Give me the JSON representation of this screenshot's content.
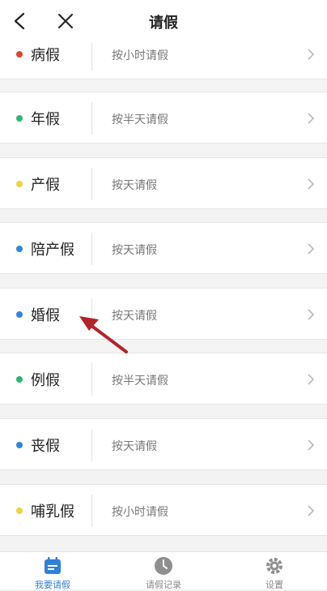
{
  "header": {
    "title": "请假"
  },
  "leave_types": [
    {
      "name": "病假",
      "desc": "按小时请假",
      "color": "#e0452e"
    },
    {
      "name": "年假",
      "desc": "按半天请假",
      "color": "#2bb673"
    },
    {
      "name": "产假",
      "desc": "按天请假",
      "color": "#f2d23c"
    },
    {
      "name": "陪产假",
      "desc": "按天请假",
      "color": "#2f88dd"
    },
    {
      "name": "婚假",
      "desc": "按天请假",
      "color": "#2f88dd"
    },
    {
      "name": "例假",
      "desc": "按半天请假",
      "color": "#2bb673"
    },
    {
      "name": "丧假",
      "desc": "按天请假",
      "color": "#2f88dd"
    },
    {
      "name": "哺乳假",
      "desc": "按小时请假",
      "color": "#f2d23c"
    }
  ],
  "tabs": [
    {
      "label": "我要请假",
      "icon": "calendar-icon",
      "active": true
    },
    {
      "label": "请假记录",
      "icon": "clock-icon",
      "active": false
    },
    {
      "label": "设置",
      "icon": "gear-icon",
      "active": false
    }
  ],
  "colors": {
    "accent": "#2f80d6",
    "annotation_arrow": "#b3232a"
  }
}
